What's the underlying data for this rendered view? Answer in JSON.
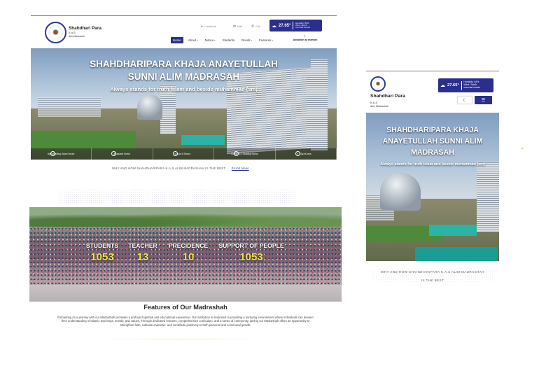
{
  "colors": {
    "primary": "#2a2f8e",
    "stat_value": "#f1e24a",
    "hero_text": "#ffffff"
  },
  "desktop": {
    "brand": {
      "name": "Shahdhari Para",
      "line2": "K.A.S",
      "line3": "Alim Madrasah"
    },
    "contacts": [
      {
        "icon": "location-icon",
        "glyph": "⌖",
        "text": "Located at"
      },
      {
        "icon": "mail-icon",
        "glyph": "✉",
        "text": "Mail"
      },
      {
        "icon": "phone-icon",
        "glyph": "✆",
        "text": "Call"
      }
    ],
    "weather": {
      "icon": "cloud-icon",
      "temperature": "27.65°",
      "humidity": "Humidity: 84%",
      "wind": "Wind: 2km/h",
      "condition": "overcast clouds"
    },
    "nav": [
      {
        "label": "Home",
        "active": true,
        "dropdown": false
      },
      {
        "label": "About",
        "active": false,
        "dropdown": true
      },
      {
        "label": "Notice",
        "active": false,
        "dropdown": true
      },
      {
        "label": "Students",
        "active": false,
        "dropdown": false
      },
      {
        "label": "Result",
        "active": false,
        "dropdown": true
      },
      {
        "label": "Features",
        "active": false,
        "dropdown": true
      }
    ],
    "user": {
      "theme_icon": "moon-icon",
      "name": "Abdullah al mamun"
    },
    "hero": {
      "title_line1": "SHAHDHARIPARA KHAJA ANAYETULLAH",
      "title_line2": "SUNNI ALIM MADRASAH",
      "tagline": "Always stands for truth Islam and beside muhammad (sm)",
      "slides": [
        {
          "num": "1",
          "label": "Main Building: Allam Sector"
        },
        {
          "num": "2",
          "label": "Ekadashi Sector"
        },
        {
          "num": "3",
          "label": "Auto B Sector"
        },
        {
          "num": "4",
          "label": "Class 1 & 2 Building Sector"
        },
        {
          "num": "5",
          "label": "Sport Area"
        }
      ]
    },
    "why": {
      "text": "WHY AND HOW SHAHDHARIPARA K.A.S ALIM MADRASHAH IS THE BEST",
      "enroll": "Enroll Now!"
    },
    "stats": [
      {
        "label": "STUDENTS",
        "value": "1053"
      },
      {
        "label": "TEACHER",
        "value": "13"
      },
      {
        "label": "PRECIDENCE",
        "value": "10"
      },
      {
        "label": "SUPPORT OF PEOPLE",
        "value": "1053"
      }
    ],
    "features": {
      "heading": "Features of Our Madrashah",
      "body": "Embarking on a journey with our Madrashah promises a profound spiritual and educational experience. Our institution is dedicated to providing a nurturing environment where individuals can deepen their understanding of Islamic teachings, morals, and values. Through dedicated mentors, comprehensive curriculum, and a sense of community, joining our Madrashah offers an opportunity to strengthen faith, cultivate character, and contribute positively to both personal and communal growth."
    }
  },
  "mobile": {
    "brand": {
      "name": "Shahdhari Para",
      "line2": "K.A.S",
      "line3": "Alim Madrashah"
    },
    "weather": {
      "icon": "cloud-icon",
      "temperature": "27.65°",
      "humidity": "Humidity: 84%",
      "wind": "Wind: 2km/h",
      "condition": "overcast clouds"
    },
    "theme_icon": "moon-icon",
    "menu_icon": "menu-icon",
    "hero": {
      "title_line1": "SHAHDHARIPARA KHAJA",
      "title_line2": "ANAYETULLAH SUNNI ALIM",
      "title_line3": "MADRASAH",
      "tagline": "Always stands for truth Islam and beside muhammad (sm)"
    },
    "why_line1": "WHY AND HOW SHAHDHARIPARA K.A.S ALIM MADRASHAH",
    "why_line2": "IS THE BEST"
  }
}
